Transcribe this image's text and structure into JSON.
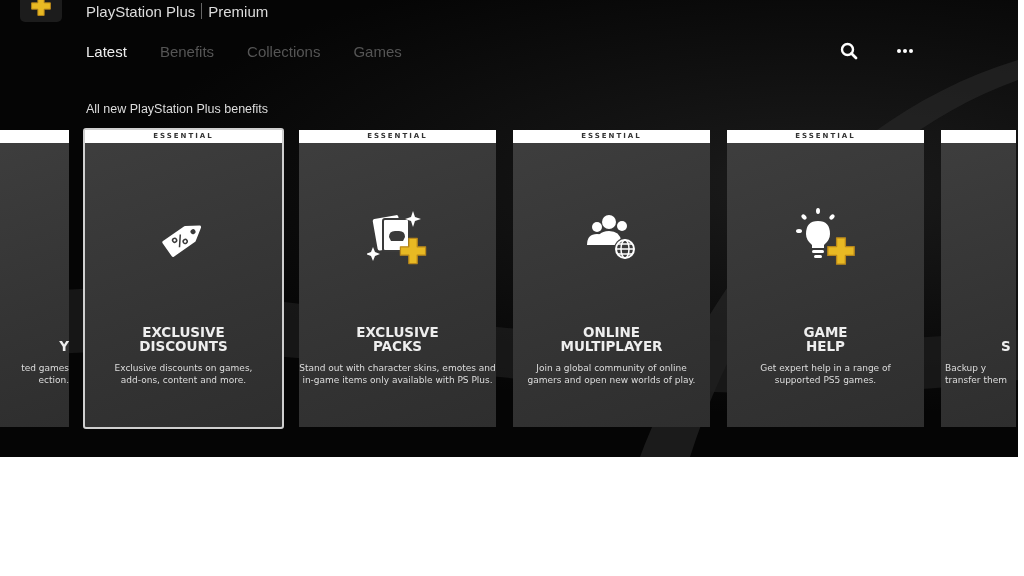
{
  "header": {
    "title": "PlayStation Plus",
    "plan": "Premium"
  },
  "tabs": [
    {
      "label": "Latest",
      "selected": true
    },
    {
      "label": "Benefits",
      "selected": false
    },
    {
      "label": "Collections",
      "selected": false
    },
    {
      "label": "Games",
      "selected": false
    }
  ],
  "section_title": "All new PlayStation Plus benefits",
  "cards": [
    {
      "kind": "clipped-left",
      "title_lines": [
        "Y"
      ],
      "description_lines": [
        "ted games",
        "ection."
      ]
    },
    {
      "kind": "full",
      "tier": "ESSENTIAL",
      "focused": true,
      "title_lines": [
        "EXCLUSIVE",
        "DISCOUNTS"
      ],
      "description_lines": [
        "Exclusive discounts on games,",
        "add-ons, content and more."
      ]
    },
    {
      "kind": "full",
      "tier": "ESSENTIAL",
      "focused": false,
      "title_lines": [
        "EXCLUSIVE",
        "PACKS"
      ],
      "description_lines": [
        "Stand out with character skins, emotes and",
        "in-game items only available with PS Plus."
      ]
    },
    {
      "kind": "full",
      "tier": "ESSENTIAL",
      "focused": false,
      "title_lines": [
        "ONLINE",
        "MULTIPLAYER"
      ],
      "description_lines": [
        "Join a global community of online",
        "gamers and open new worlds of play."
      ]
    },
    {
      "kind": "full",
      "tier": "ESSENTIAL",
      "focused": false,
      "title_lines": [
        "GAME",
        "HELP"
      ],
      "description_lines": [
        "Get expert help in a range of",
        "supported PS5 games."
      ]
    },
    {
      "kind": "clipped-right",
      "title_lines": [
        "S"
      ],
      "description_lines": [
        "Backup y",
        "transfer them"
      ]
    }
  ]
}
